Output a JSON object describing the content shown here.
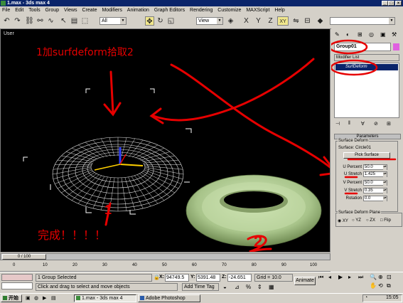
{
  "window": {
    "title": "1.max - 3ds max 4",
    "minimize": "_",
    "maximize": "□",
    "close": "×"
  },
  "menu": [
    "File",
    "Edit",
    "Tools",
    "Group",
    "Views",
    "Create",
    "Modifiers",
    "Animation",
    "Graph Editors",
    "Rendering",
    "Customize",
    "MAXScript",
    "Help"
  ],
  "toolbar": {
    "selection_filter": "All",
    "reference_coord": "View",
    "axis_buttons": [
      "X",
      "Y",
      "Z",
      "XY"
    ]
  },
  "viewport": {
    "label": "User",
    "annotation_top": "1加surfdeform拾取2",
    "annotation_done": "完成！！！！",
    "label_1": "1",
    "label_2": "2",
    "colors": {
      "annotation": "#e60000",
      "torus_wire": "#e8e8e8",
      "torus_solid": "#a8c48a"
    }
  },
  "command_panel": {
    "object_name": "Group01",
    "object_color": "#e060e0",
    "modifier_list": "Modifier List",
    "stack_item": "SurfDeform",
    "rollout_title": "Parameters",
    "group_label": "Surface Deform",
    "surface_label": "Surface: Circle01",
    "pick_button": "Pick Surface",
    "params": [
      {
        "label": "U Percent",
        "value": "50.0"
      },
      {
        "label": "U Stretch",
        "value": "1.425"
      },
      {
        "label": "V Percent",
        "value": "50.0"
      },
      {
        "label": "V Stretch",
        "value": "0.35"
      },
      {
        "label": "Rotation",
        "value": "0.0"
      }
    ],
    "plane_group": "Surface Deform Plane",
    "plane_options": [
      "XY",
      "YZ",
      "ZX",
      "Flip"
    ]
  },
  "timeline": {
    "slider": "0 / 100",
    "ticks": [
      "0",
      "10",
      "20",
      "30",
      "40",
      "50",
      "60",
      "70",
      "80",
      "90",
      "100"
    ]
  },
  "status": {
    "selection": "1 Group Selected",
    "prompt": "Click and drag to select and move objects",
    "x_label": "X:",
    "x": "94749.5",
    "y_label": "Y:",
    "y": "5391.48",
    "z_label": "Z:",
    "z": "-24.651",
    "grid": "Grid = 10.0",
    "add_time_tag": "Add Time Tag",
    "animate": "Animate"
  },
  "taskbar": {
    "start": "开始",
    "tasks": [
      "1.max - 3ds max 4",
      "Adobe Photoshop"
    ],
    "clock": "15:05"
  }
}
